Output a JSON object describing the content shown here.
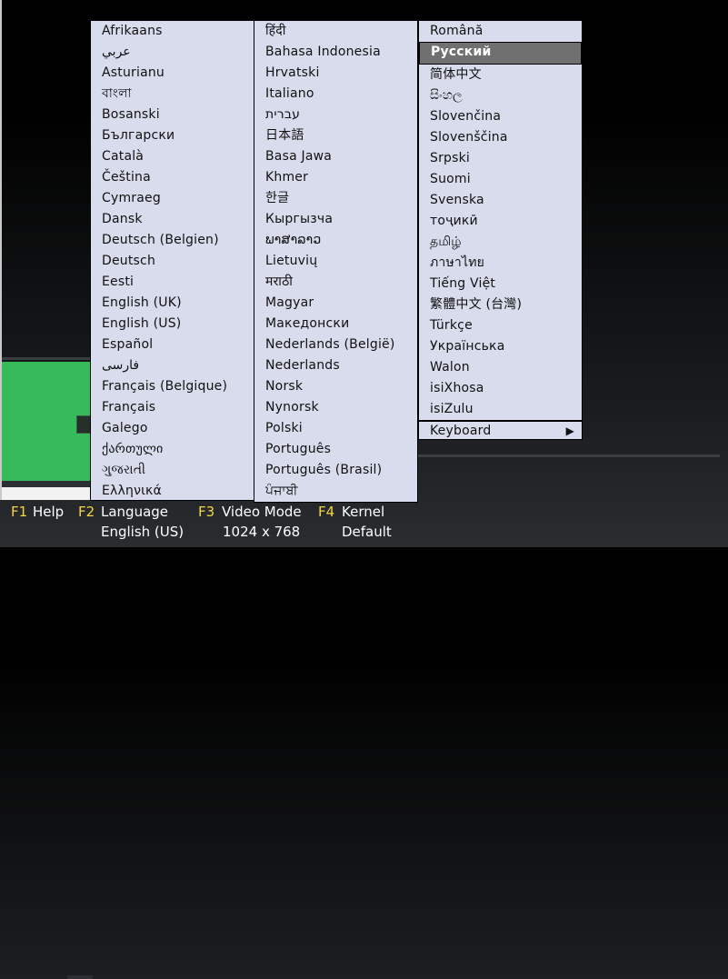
{
  "columns": [
    [
      "Afrikaans",
      "عربي",
      "Asturianu",
      "বাংলা",
      "Bosanski",
      "Български",
      "Català",
      "Čeština",
      "Cymraeg",
      "Dansk",
      "Deutsch (Belgien)",
      "Deutsch",
      "Eesti",
      "English (UK)",
      "English (US)",
      "Español",
      "فارسی",
      "Français (Belgique)",
      "Français",
      "Galego",
      "ქართული",
      "ગુજરાતી",
      "Ελληνικά"
    ],
    [
      "हिंदी",
      "Bahasa Indonesia",
      "Hrvatski",
      "Italiano",
      "עברית",
      "日本語",
      "Basa Jawa",
      "Khmer",
      "한글",
      "Кыргызча",
      "ພາສາລາວ",
      "Lietuvių",
      "मराठी",
      "Magyar",
      "Македонски",
      "Nederlands (België)",
      "Nederlands",
      "Norsk",
      "Nynorsk",
      "Polski",
      "Português",
      "Português (Brasil)",
      "ਪੰਜਾਬੀ"
    ],
    [
      "Română",
      "Русский",
      "简体中文",
      "සිංහල",
      "Slovenčina",
      "Slovenščina",
      "Srpski",
      "Suomi",
      "Svenska",
      "тоҷикӣ",
      "தமிழ்",
      "ภาษาไทย",
      "Tiếng Việt",
      "繁體中文 (台灣)",
      "Türkçe",
      "Українська",
      "Walon",
      "isiXhosa",
      "isiZulu"
    ]
  ],
  "selected": "Русский",
  "keyboard_label": "Keyboard",
  "keyboard_arrow": "▶",
  "bottom": {
    "f1": {
      "key": "F1",
      "label": "Help"
    },
    "f2": {
      "key": "F2",
      "label": "Language",
      "value": "English (US)"
    },
    "f3": {
      "key": "F3",
      "label": "Video Mode",
      "value": "1024 x 768"
    },
    "f4": {
      "key": "F4",
      "label": "Kernel",
      "value": "Default"
    }
  },
  "colors": {
    "menu_bg": "#d8dcec",
    "highlight": "#707070",
    "fkey": "#f5d547",
    "green": "#35bb5a"
  }
}
